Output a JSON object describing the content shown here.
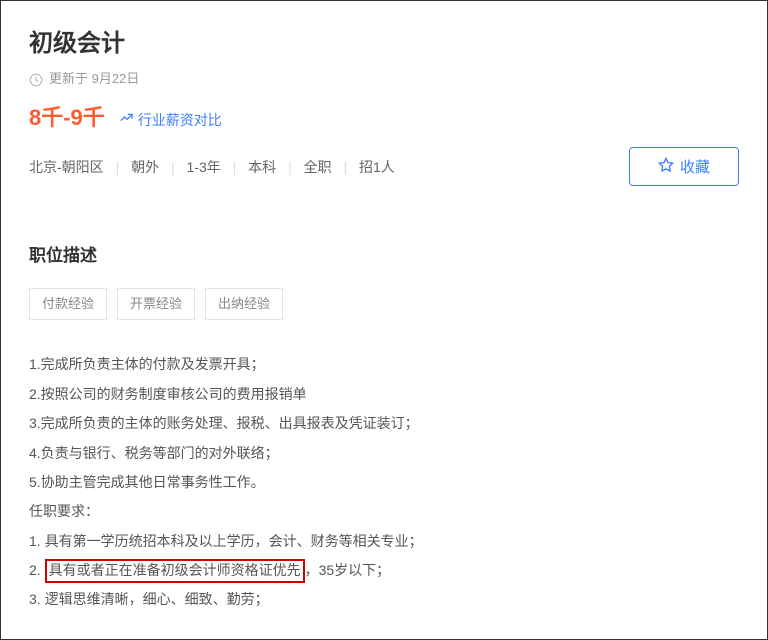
{
  "header": {
    "title": "初级会计",
    "update_prefix": "更新于",
    "update_date": "9月22日",
    "salary": "8千-9千",
    "compare_label": "行业薪资对比"
  },
  "meta": {
    "city": "北京",
    "district": "朝阳区",
    "area": "朝外",
    "experience": "1-3年",
    "education": "本科",
    "job_type": "全职",
    "headcount": "招1人"
  },
  "favorite_label": "收藏",
  "section": {
    "title": "职位描述"
  },
  "tags": [
    "付款经验",
    "开票经验",
    "出纳经验"
  ],
  "description": {
    "items": [
      "1.完成所负责主体的付款及发票开具；",
      "2.按照公司的财务制度审核公司的费用报销单",
      "3.完成所负责的主体的账务处理、报税、出具报表及凭证装订；",
      "4.负责与银行、税务等部门的对外联络；",
      "5.协助主管完成其他日常事务性工作。"
    ],
    "req_title": "任职要求：",
    "requirements": [
      {
        "prefix": "1. ",
        "text": "具有第一学历统招本科及以上学历，会计、财务等相关专业；"
      },
      {
        "prefix": "2. ",
        "highlight": "具有或者正在准备初级会计师资格证优先",
        "suffix": "，35岁以下；"
      },
      {
        "prefix": "3. ",
        "text": "逻辑思维清晰，细心、细致、勤劳；"
      }
    ]
  }
}
